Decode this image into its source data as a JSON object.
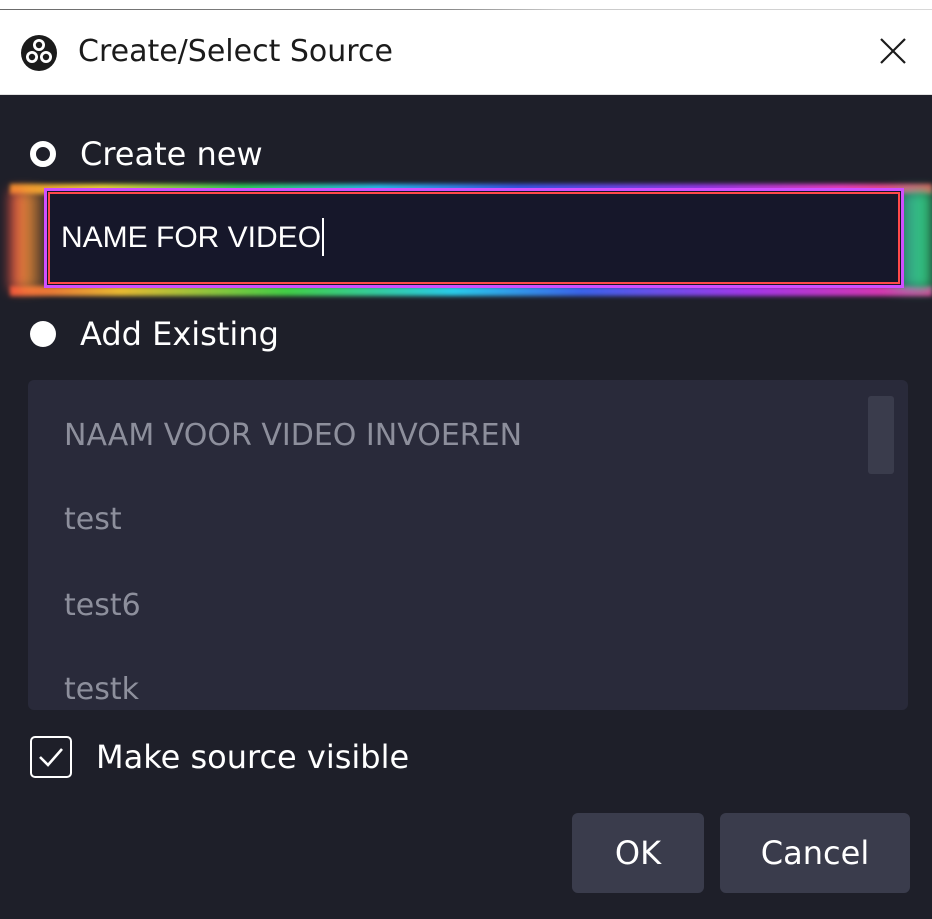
{
  "window": {
    "title": "Create/Select Source",
    "icon": "obs-logo-icon",
    "close_icon": "close-icon"
  },
  "create_new": {
    "label": "Create new",
    "selected": true,
    "input_value": "NAME FOR VIDEO"
  },
  "add_existing": {
    "label": "Add Existing",
    "selected": false,
    "items": [
      "NAAM VOOR VIDEO INVOEREN",
      "test",
      "test6",
      "testk"
    ]
  },
  "make_visible": {
    "label": "Make source visible",
    "checked": true
  },
  "buttons": {
    "ok": "OK",
    "cancel": "Cancel"
  },
  "colors": {
    "background": "#1e1f29",
    "list_background": "#292a3a",
    "button_background": "#3a3c4c",
    "list_text": "#8d8f9c",
    "input_border": "#d04fff"
  }
}
